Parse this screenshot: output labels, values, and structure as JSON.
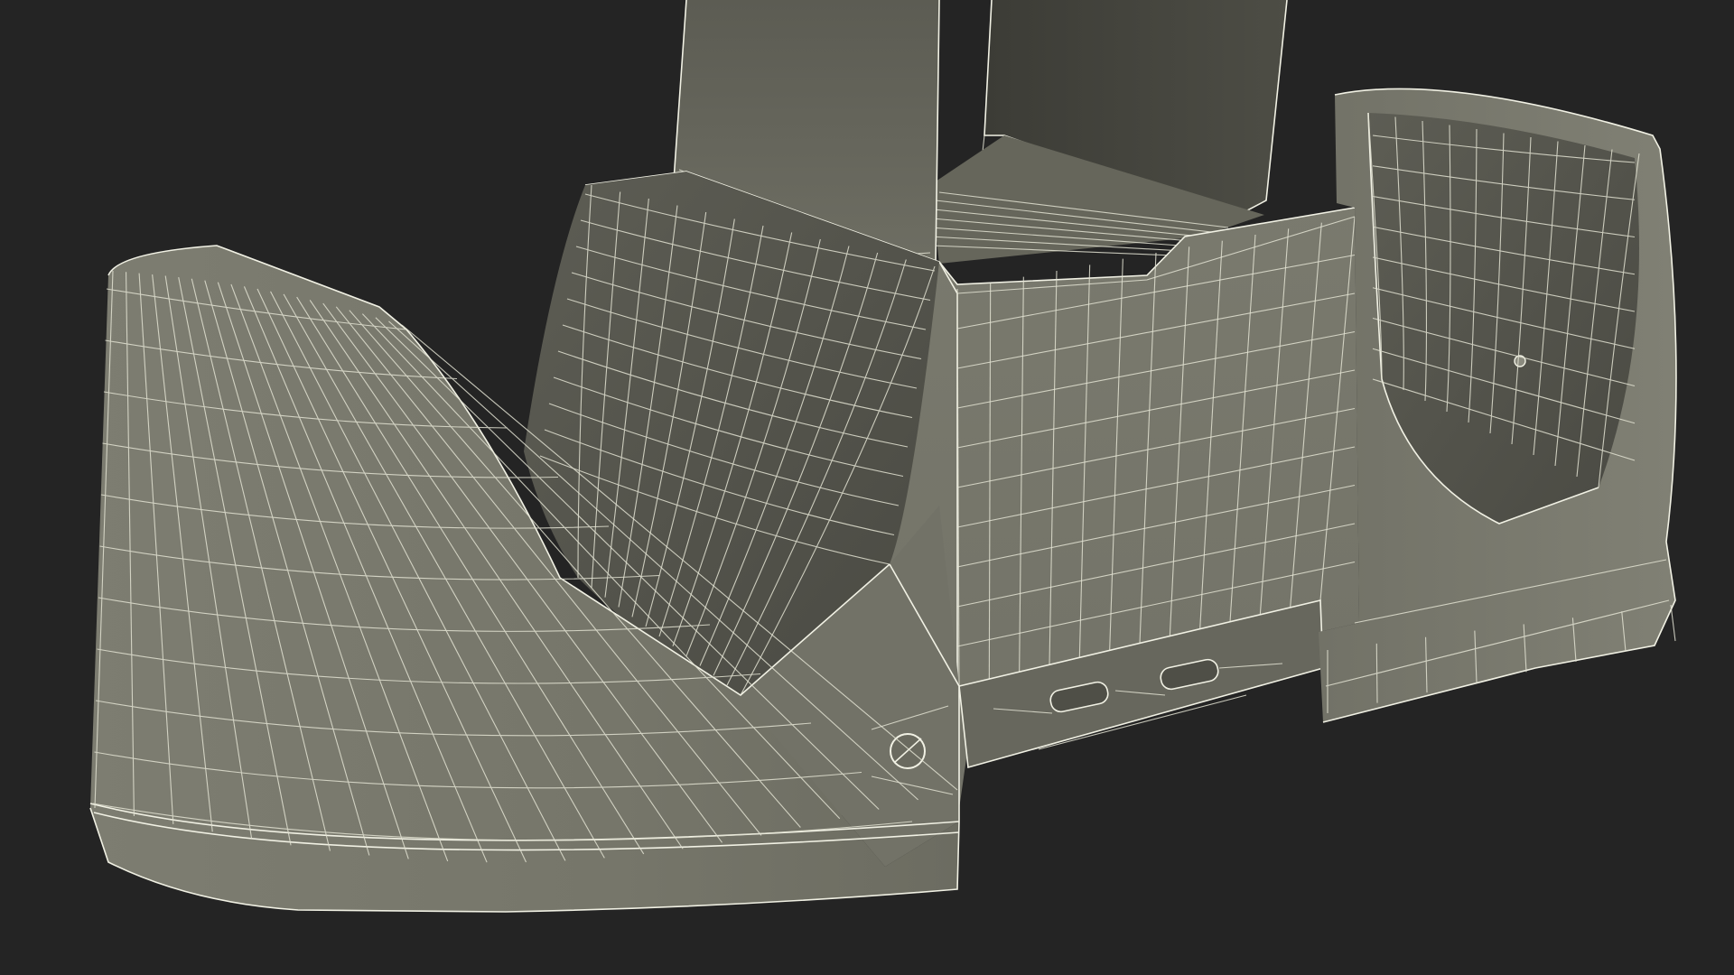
{
  "scene": {
    "subject": "charging-dock-wireframe-render",
    "colors": {
      "background": "#242424",
      "surface_light": "#7c7c70",
      "surface_mid": "#6f6f64",
      "surface_dark": "#55554c",
      "surface_shadow": "#45453e",
      "wire": "#e2e2d2"
    }
  }
}
